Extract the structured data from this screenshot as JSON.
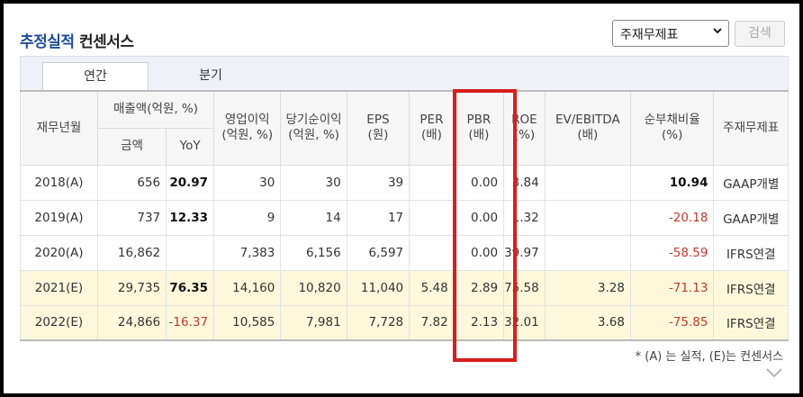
{
  "header": {
    "title_main": "추정실적",
    "title_sub": "컨센서스",
    "select_value": "주재무제표",
    "search_label": "검색"
  },
  "tabs": [
    {
      "label": "연간",
      "active": true
    },
    {
      "label": "분기",
      "active": false
    }
  ],
  "table": {
    "header": {
      "period": "재무년월",
      "sales_group": "매출액(억원, %)",
      "amount": "금액",
      "yoy": "YoY",
      "op_income": [
        "영업이익",
        "(억원, %)"
      ],
      "net_income": [
        "당기순이익",
        "(억원, %)"
      ],
      "eps": [
        "EPS",
        "(원)"
      ],
      "per": [
        "PER",
        "(배)"
      ],
      "pbr": [
        "PBR",
        "(배)"
      ],
      "roe": [
        "ROE",
        "(%)"
      ],
      "ev_ebitda": [
        "EV/EBITDA",
        "(배)"
      ],
      "net_debt": [
        "순부채비율",
        "(%)"
      ],
      "statement": "주재무제표"
    },
    "rows": [
      {
        "period": "2018(A)",
        "amount": "656",
        "yoy": "20.97",
        "op": "30",
        "net": "30",
        "eps": "39",
        "per": "",
        "pbr": "0.00",
        "roe": "3.84",
        "ev": "",
        "debt": "10.94",
        "std": "GAAP개별",
        "estimate": false,
        "debt_neg": false
      },
      {
        "period": "2019(A)",
        "amount": "737",
        "yoy": "12.33",
        "op": "9",
        "net": "14",
        "eps": "17",
        "per": "",
        "pbr": "0.00",
        "roe": "1.32",
        "ev": "",
        "debt": "-20.18",
        "std": "GAAP개별",
        "estimate": false,
        "debt_neg": true
      },
      {
        "period": "2020(A)",
        "amount": "16,862",
        "yoy": "",
        "op": "7,383",
        "net": "6,156",
        "eps": "6,597",
        "per": "",
        "pbr": "0.00",
        "roe": "39.97",
        "ev": "",
        "debt": "-58.59",
        "std": "IFRS연결",
        "estimate": false,
        "debt_neg": true
      },
      {
        "period": "2021(E)",
        "amount": "29,735",
        "yoy": "76.35",
        "op": "14,160",
        "net": "10,820",
        "eps": "11,040",
        "per": "5.48",
        "pbr": "2.89",
        "roe": "75.58",
        "ev": "3.28",
        "debt": "-71.13",
        "std": "IFRS연결",
        "estimate": true,
        "debt_neg": true
      },
      {
        "period": "2022(E)",
        "amount": "24,866",
        "yoy": "-16.37",
        "op": "10,585",
        "net": "7,981",
        "eps": "7,728",
        "per": "7.82",
        "pbr": "2.13",
        "roe": "32.01",
        "ev": "3.68",
        "debt": "-75.85",
        "std": "IFRS연결",
        "estimate": true,
        "debt_neg": true
      }
    ]
  },
  "footnote": "* (A) 는 실적, (E)는 컨센서스",
  "colors": {
    "title_accent": "#1f4e96",
    "negative": "#c0392b",
    "estimate_row": "#fdf8dc",
    "highlight_box": "#d81e1e"
  }
}
